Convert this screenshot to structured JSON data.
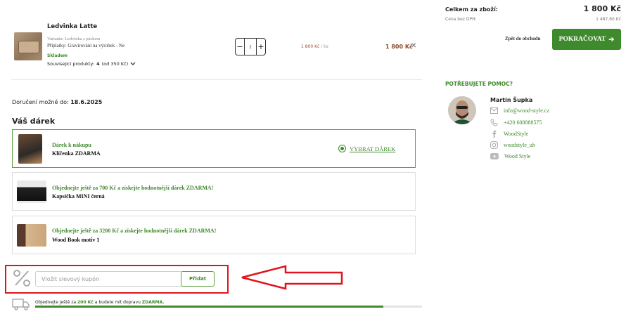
{
  "product": {
    "name": "Ledvinka Latte",
    "variant": "Varianta: Ledvinka s páskem",
    "option": "Příplatky: Gravírování na výrobek - Ne",
    "stock": "Skladem",
    "related_prefix": "Související produkty:",
    "related_count": "4",
    "related_suffix": "(od 350 Kč)",
    "quantity": "1",
    "unit_price": "1 800 Kč",
    "unit_suffix": "/ ks",
    "total_price": "1 800 Kč"
  },
  "delivery": {
    "label": "Doručení možné do:",
    "date": "18.6.2025"
  },
  "gifts": {
    "heading": "Váš dárek",
    "items": [
      {
        "title": "Dárek k nákupu",
        "name": "Klíčenka ZDARMA",
        "action": "VYBRAT DÁREK"
      },
      {
        "title": "Objednejte ještě za 700 Kč a získejte hodnotnější dárek ZDARMA!",
        "name": "Kapsička MINI černá"
      },
      {
        "title": "Objednejte ještě za 3200 Kč a získejte hodnotnější dárek ZDARMA!",
        "name": "Wood Book motiv 1"
      }
    ]
  },
  "coupon": {
    "placeholder": "Vložit slevový kupón",
    "button": "Přidat"
  },
  "shipping": {
    "prefix": "Objednejte ještě za",
    "amount": "200 Kč",
    "middle": "a budete mít dopravu",
    "free": "ZDARMA.",
    "progress": 0.9
  },
  "summary": {
    "total_label": "Celkem za zboží:",
    "total_value": "1 800 Kč",
    "vat_label": "Cena bez DPH:",
    "vat_value": "1 487,60 Kč",
    "back_label": "Zpět do obchodu",
    "continue_label": "POKRAČOVAT"
  },
  "help": {
    "heading": "POTŘEBUJETE POMOC?",
    "name": "Martin Šupka",
    "contacts": [
      {
        "icon": "mail-icon",
        "text": "info@wood-style.cz"
      },
      {
        "icon": "phone-icon",
        "text": "+420 608888575"
      },
      {
        "icon": "facebook-icon",
        "text": "WoodStyle"
      },
      {
        "icon": "instagram-icon",
        "text": "woodstyle_uh"
      },
      {
        "icon": "youtube-icon",
        "text": "Wood Style"
      }
    ]
  },
  "colors": {
    "accent": "#3f8a2c",
    "price": "#8b4a2b",
    "highlight": "#e0141e"
  }
}
